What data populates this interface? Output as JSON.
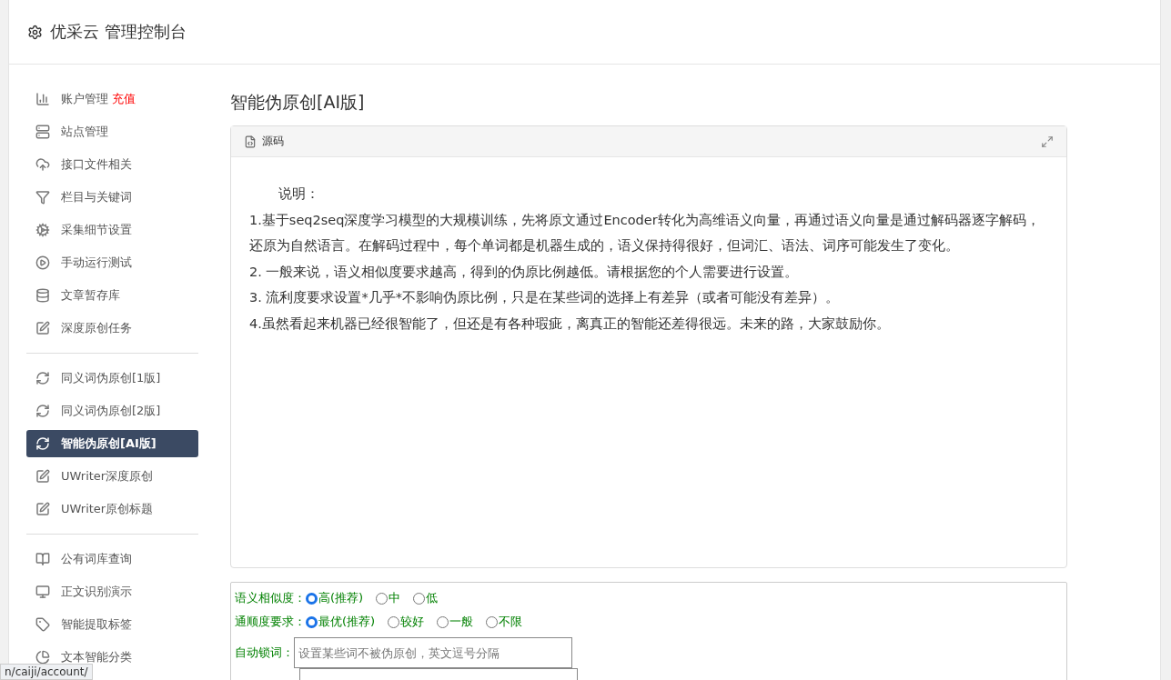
{
  "header": {
    "title": "优采云 管理控制台"
  },
  "sidebar": {
    "groups": [
      {
        "items": [
          {
            "kind": "chart",
            "label": "账户管理",
            "badge": "充值",
            "selected": false
          },
          {
            "kind": "server",
            "label": "站点管理",
            "selected": false
          },
          {
            "kind": "cloud",
            "label": "接口文件相关",
            "selected": false
          },
          {
            "kind": "filter",
            "label": "栏目与关键词",
            "selected": false
          },
          {
            "kind": "cogs",
            "label": "采集细节设置",
            "selected": false
          },
          {
            "kind": "play",
            "label": "手动运行测试",
            "selected": false
          },
          {
            "kind": "database",
            "label": "文章暂存库",
            "selected": false
          },
          {
            "kind": "edit",
            "label": "深度原创任务",
            "selected": false
          }
        ]
      },
      {
        "items": [
          {
            "kind": "refresh",
            "label": "同义词伪原创[1版]",
            "selected": false
          },
          {
            "kind": "refresh",
            "label": "同义词伪原创[2版]",
            "selected": false
          },
          {
            "kind": "refresh",
            "label": "智能伪原创[AI版]",
            "selected": true
          },
          {
            "kind": "edit",
            "label": "UWriter深度原创",
            "selected": false
          },
          {
            "kind": "edit",
            "label": "UWriter原创标题",
            "selected": false
          }
        ]
      },
      {
        "items": [
          {
            "kind": "book",
            "label": "公有词库查询",
            "selected": false
          },
          {
            "kind": "monitor",
            "label": "正文识别演示",
            "selected": false
          },
          {
            "kind": "tag",
            "label": "智能提取标签",
            "selected": false
          },
          {
            "kind": "pie",
            "label": "文本智能分类",
            "selected": false
          }
        ]
      }
    ]
  },
  "page_title": "智能伪原创[AI版]",
  "editor": {
    "toolbar_label": "源码",
    "heading": "说明：",
    "paragraphs": [
      "1.基于seq2seq深度学习模型的大规模训练，先将原文通过Encoder转化为高维语义向量，再通过语义向量是通过解码器逐字解码，还原为自然语言。在解码过程中，每个单词都是机器生成的，语义保持得很好，但词汇、语法、词序可能发生了变化。",
      "2. 一般来说，语义相似度要求越高，得到的伪原比例越低。请根据您的个人需要进行设置。",
      "3. 流利度要求设置*几乎*不影响伪原比例，只是在某些词的选择上有差异（或者可能没有差异）。",
      "4.虽然看起来机器已经很智能了，但还是有各种瑕疵，离真正的智能还差得很远。未来的路，大家鼓励你。"
    ]
  },
  "options": [
    {
      "label": "语义相似度：",
      "choices": [
        {
          "label": "高(推荐)",
          "selected": true
        },
        {
          "label": "中",
          "selected": false
        },
        {
          "label": "低",
          "selected": false
        }
      ]
    },
    {
      "label": "通顺度要求：",
      "choices": [
        {
          "label": "最优(推荐)",
          "selected": true
        },
        {
          "label": "较好",
          "selected": false
        },
        {
          "label": "一般",
          "selected": false
        },
        {
          "label": "不限",
          "selected": false
        }
      ]
    }
  ],
  "lock_words": {
    "label": "自动锁词：",
    "placeholder": "设置某些词不被伪原创，英文逗号分隔"
  },
  "status_bar": {
    "url": "n/caiji/account/"
  }
}
